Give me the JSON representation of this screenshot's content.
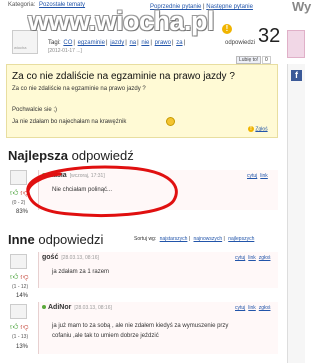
{
  "watermark": "www.wiocha.pl",
  "header": {
    "category_label": "Kategoria:",
    "category_value": "Pozostałe tematy",
    "prev_label": "Poprzednie pytanie",
    "next_label": "Następne pytanie",
    "separator": "|",
    "sidebar_cut": "Wy"
  },
  "question": {
    "avatar_text": "wiocha",
    "tags_label": "Tagi:",
    "tags": [
      "CO",
      "egzaminie",
      "jazdy",
      "na",
      "nie",
      "prawo",
      "za"
    ],
    "date": "[2012-01-17 ...]",
    "votes": "32",
    "votes_label": "odpowiedzi",
    "fb_like": "Lubię to!",
    "fb_count": "0",
    "title": "Za co nie zdaliście na egzaminie na prawo jazdy ?",
    "subtitle": "Za co nie zdaliście na egzaminie na prawo jazdy ?",
    "body_line1": "Pochwalcie sie ;)",
    "body_line2": "Ja nie zdałam bo najechałam na krawężnik",
    "report_label": "Zgłoś"
  },
  "best": {
    "heading_bold": "Najlepsza",
    "heading_rest": "odpowiedź",
    "author": "Kasia",
    "when": "[wczoraj, 17:31]",
    "links": [
      "cytuj",
      "link"
    ],
    "text": "Nie chciałam polinąć...",
    "score": "(0 - 2)",
    "percent": "83%"
  },
  "others": {
    "heading_bold": "Inne",
    "heading_rest": "odpowiedzi",
    "sort_label": "Sortuj wg:",
    "sort_options": [
      "najstarszych",
      "najnowszych",
      "najlepszych"
    ],
    "answers": [
      {
        "author": "gość",
        "when": "[28.03.13, 08:16]",
        "links": [
          "cytuj",
          "link",
          "zgłoś"
        ],
        "text_line1": "ja zdałam za 1 razem",
        "text_line2": "",
        "score": "(1 - 12)",
        "percent": "14%"
      },
      {
        "author": "AdiNor",
        "when": "[28.03.13, 08:16]",
        "links": [
          "cytuj",
          "link",
          "zgłoś"
        ],
        "text_line1": "ja już mam to za sobą , ale nie zdałem kiedyś za wymuszenie przy",
        "text_line2": "cofaniu ,ale tak to umiem dobrze jeździć",
        "score": "(1 - 13)",
        "percent": "13%"
      }
    ]
  },
  "colors": {
    "question_bg": "#fffad5",
    "link": "#2255aa",
    "annotation_red": "#e01010",
    "thumb_up": "#3a9a2a",
    "thumb_down": "#c0392b"
  }
}
